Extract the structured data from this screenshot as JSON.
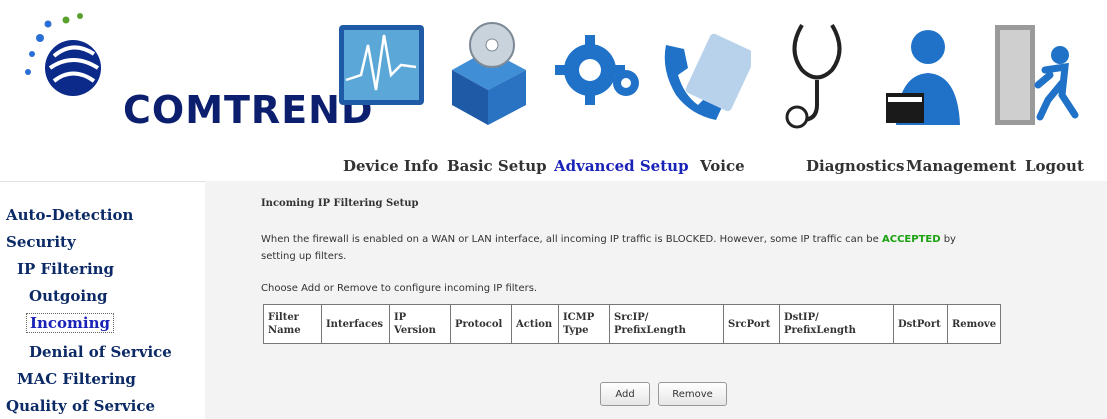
{
  "header": {
    "logo_text": "COMTREND",
    "nav": [
      {
        "label": "Device Info",
        "icon": "device-info-icon"
      },
      {
        "label": "Basic Setup",
        "icon": "basic-setup-icon"
      },
      {
        "label": "Advanced Setup",
        "icon": "advanced-setup-icon",
        "active": true
      },
      {
        "label": "Voice",
        "icon": "voice-icon"
      },
      {
        "label": "Diagnostics",
        "icon": "diagnostics-icon"
      },
      {
        "label": "Management",
        "icon": "management-icon"
      },
      {
        "label": "Logout",
        "icon": "logout-icon"
      }
    ]
  },
  "sidebar": {
    "items": [
      {
        "label": "Auto-Detection"
      },
      {
        "label": "Security"
      },
      {
        "label": "IP Filtering"
      },
      {
        "label": "Outgoing"
      },
      {
        "label": "Incoming",
        "active": true
      },
      {
        "label": "Denial of Service"
      },
      {
        "label": "MAC Filtering"
      },
      {
        "label": "Quality of Service"
      }
    ]
  },
  "main": {
    "title": "Incoming IP Filtering Setup",
    "desc_part1": "When the firewall is enabled on a WAN or LAN interface, all incoming IP traffic is BLOCKED. However, some IP traffic can be",
    "desc_accepted": "ACCEPTED",
    "desc_part2": "by",
    "desc_line2": "setting up filters.",
    "choose_text": "Choose Add or Remove to configure incoming IP filters.",
    "table": {
      "headers": [
        "Filter Name",
        "Interfaces",
        "IP Version",
        "Protocol",
        "Action",
        "ICMP Type",
        "SrcIP/ PrefixLength",
        "SrcPort",
        "DstIP/ PrefixLength",
        "DstPort",
        "Remove"
      ]
    },
    "buttons": {
      "add": "Add",
      "remove": "Remove"
    }
  },
  "colors": {
    "accent_link": "#1a23b8",
    "accepted": "#1aa10f",
    "logo": "#0b1f6e"
  }
}
